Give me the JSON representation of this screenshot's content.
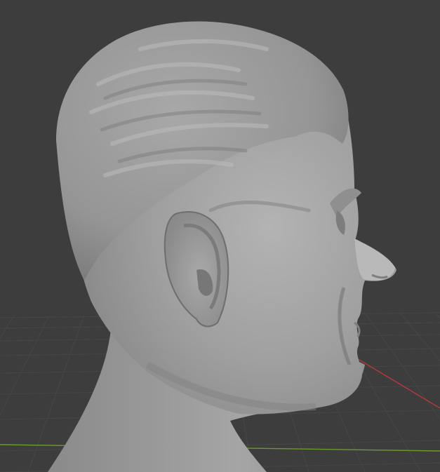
{
  "viewport": {
    "background_color": "#3d3d3d",
    "grid_color": "#474747",
    "axis_x_color": "#b5393e",
    "axis_y_color": "#6b9a2c",
    "mesh_color": "#9c9c9c",
    "grid_visible": true,
    "object": "sculpted-head-bust",
    "shading": "solid"
  }
}
